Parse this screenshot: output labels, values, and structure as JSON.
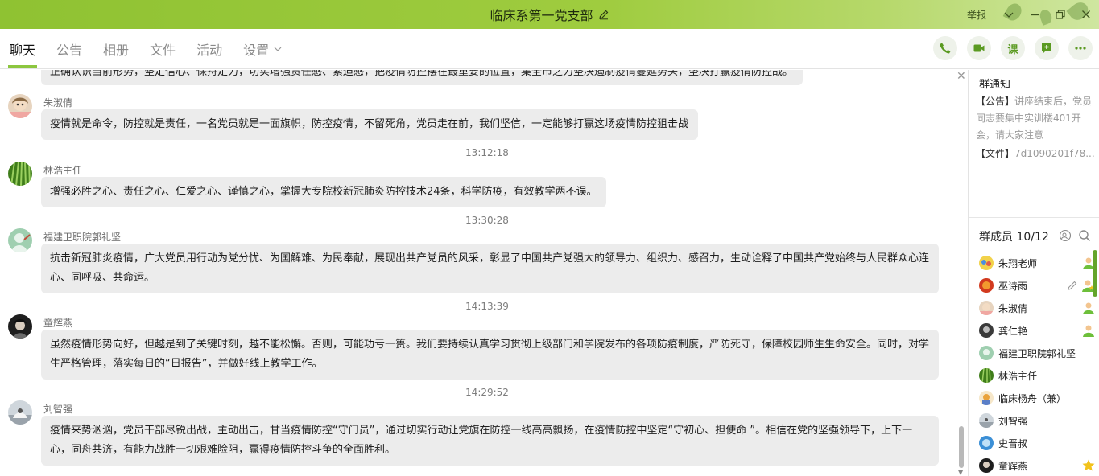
{
  "window": {
    "title": "临床系第一党支部",
    "report_label": "举报"
  },
  "tabs": [
    {
      "label": "聊天"
    },
    {
      "label": "公告"
    },
    {
      "label": "相册"
    },
    {
      "label": "文件"
    },
    {
      "label": "活动"
    },
    {
      "label": "设置"
    }
  ],
  "actions": {
    "course_label": "课"
  },
  "chat": {
    "partial_message": "正确认识当前形势，坚定信心、保持定力，切实增强责任感、紧迫感，把疫情防控摆在最重要的位置，集全市之力坚决遏制疫情蔓延势头，坚决打赢疫情防控战。",
    "messages": [
      {
        "sender": "朱淑倩",
        "text": "疫情就是命令，防控就是责任，一名党员就是一面旗帜，防控疫情，不留死角，党员走在前，我们坚信，一定能够打赢这场疫情防控狙击战"
      },
      {
        "time": "13:12:18"
      },
      {
        "sender": "林浩主任",
        "text": "增强必胜之心、责任之心、仁爱之心、谨慎之心，掌握大专院校新冠肺炎防控技术24条，科学防疫，有效教学两不误。"
      },
      {
        "time": "13:30:28"
      },
      {
        "sender": "福建卫职院郭礼坚",
        "text": "抗击新冠肺炎疫情，广大党员用行动为党分忧、为国解难、为民奉献，展现出共产党员的风采，彰显了中国共产党强大的领导力、组织力、感召力，生动诠释了中国共产党始终与人民群众心连心、同呼吸、共命运。"
      },
      {
        "time": "14:13:39"
      },
      {
        "sender": "童辉燕",
        "text": "虽然疫情形势向好，但越是到了关键时刻，越不能松懈。否则，可能功亏一篑。我们要持续认真学习贯彻上级部门和学院发布的各项防疫制度，严防死守，保障校园师生生命安全。同时，对学生严格管理，落实每日的“日报告”，并做好线上教学工作。"
      },
      {
        "time": "14:29:52"
      },
      {
        "sender": "刘智强",
        "text": "疫情来势汹汹，党员干部尽锐出战，主动出击，甘当疫情防控“守门员”，通过切实行动让党旗在防控一线高高飘扬，在疫情防控中坚定“守初心、担使命 ”。相信在党的坚强领导下，上下一心，同舟共济，有能力战胜一切艰难险阻，赢得疫情防控斗争的全面胜利。"
      }
    ]
  },
  "panel": {
    "notice_title": "群通知",
    "notice_tag": "【公告】",
    "notice_text": "讲座结束后，党员同志要集中实训楼401开会，请大家注意",
    "file_tag": "【文件】",
    "file_text": "7d1090201f78...",
    "members_title": "群成员 10/12",
    "members": [
      {
        "name": "朱翔老师",
        "role": "admin"
      },
      {
        "name": "巫诗雨",
        "role": "owner"
      },
      {
        "name": "朱淑倩",
        "role": "admin"
      },
      {
        "name": "龚仁艳",
        "role": "admin"
      },
      {
        "name": "福建卫职院郭礼坚",
        "role": ""
      },
      {
        "name": "林浩主任",
        "role": ""
      },
      {
        "name": "临床杨舟（兼）",
        "role": ""
      },
      {
        "name": "刘智强",
        "role": ""
      },
      {
        "name": "史晋叔",
        "role": ""
      },
      {
        "name": "童辉燕",
        "role": "star"
      }
    ]
  },
  "colors": {
    "accent": "#8cc63f",
    "bubble": "#ececec",
    "titlebar": "#9fcc3f"
  }
}
